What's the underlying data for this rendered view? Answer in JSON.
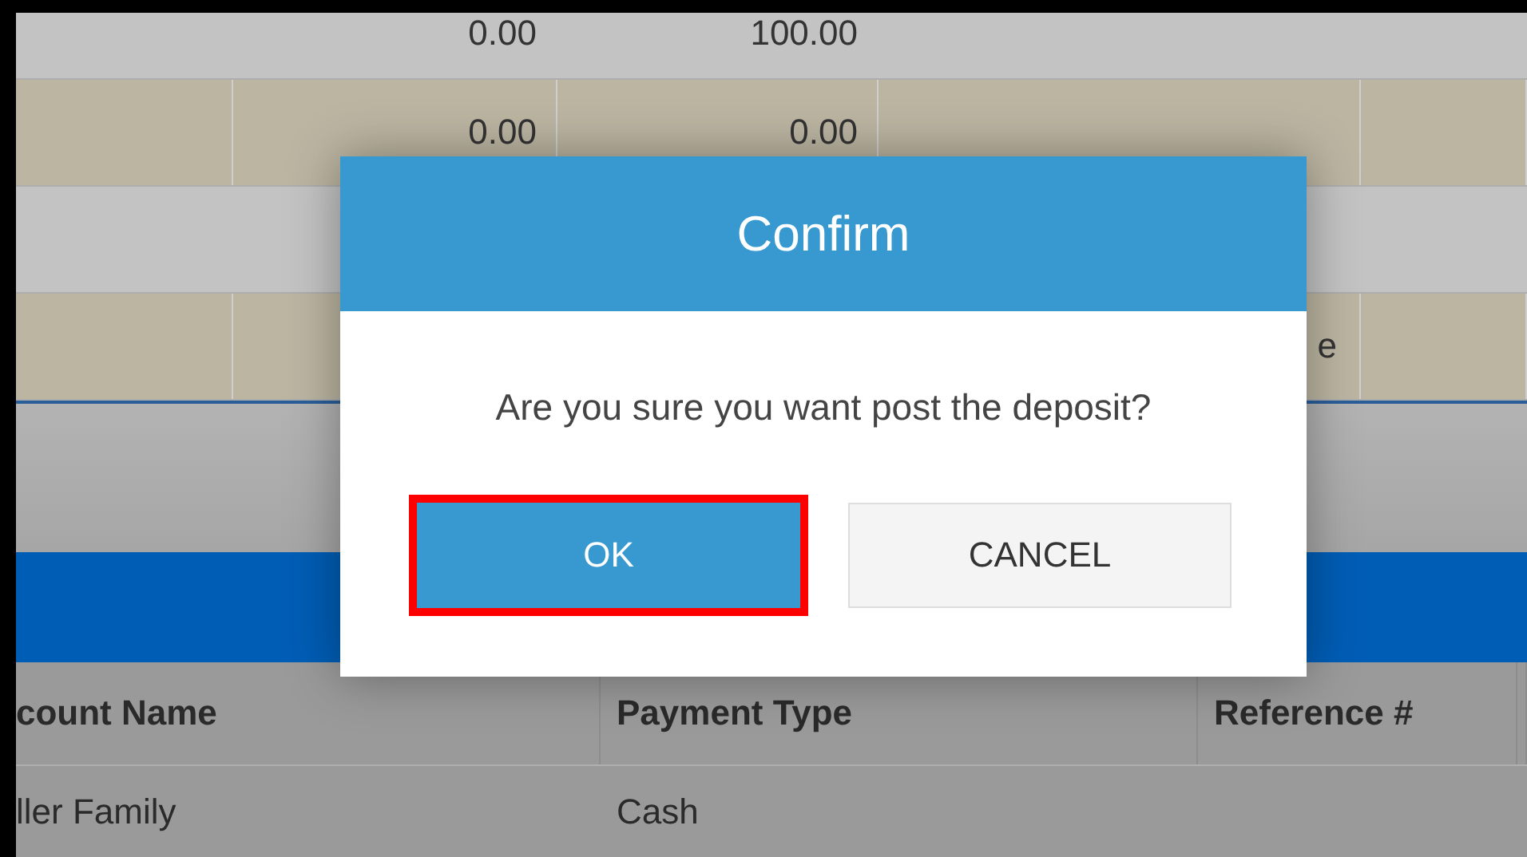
{
  "upper_table": {
    "rows": [
      {
        "column_2": "0.00",
        "column_3": "100.00"
      },
      {
        "column_2": "0.00",
        "column_3": "0.00"
      },
      {},
      {
        "column_4": "e"
      }
    ]
  },
  "lower_table": {
    "columns": [
      "count Name",
      "Payment Type",
      "Reference #"
    ],
    "rows": [
      [
        "ller Family",
        "Cash"
      ]
    ]
  },
  "dialog": {
    "title": "Confirm",
    "message": "Are you sure you want post the deposit?",
    "buttons": [
      {
        "label": "OK",
        "kind": "primary",
        "highlighted": true
      },
      {
        "label": "CANCEL",
        "kind": "secondary",
        "highlighted": false
      }
    ]
  }
}
